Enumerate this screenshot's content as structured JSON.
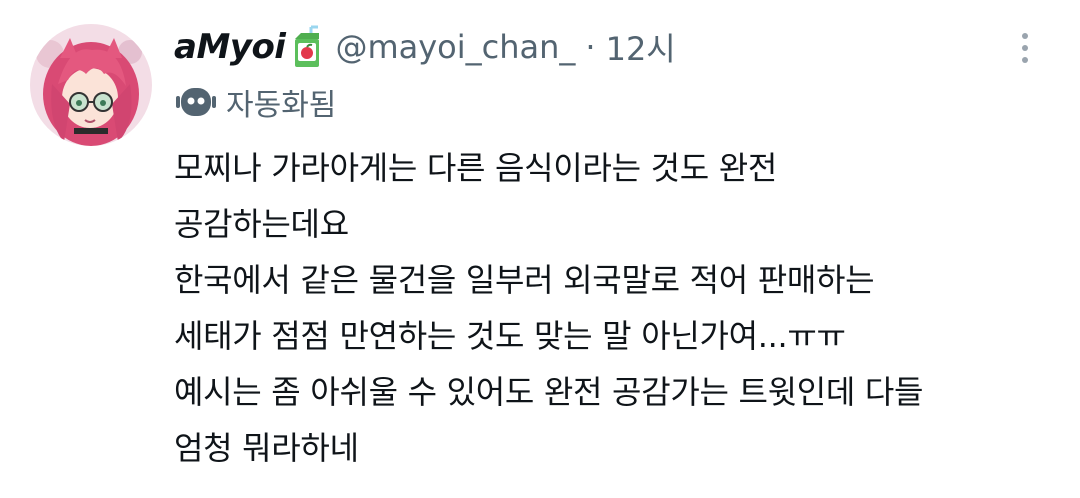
{
  "user": {
    "display_name": "aMyoi",
    "display_name_icon": "juice-box-icon",
    "handle": "@mayoi_chan_",
    "separator": "·",
    "time": "12시"
  },
  "automated": {
    "icon": "bot-icon",
    "label": "자동화됨"
  },
  "tweet": {
    "lines": [
      "모찌나 가라아게는 다른 음식이라는 것도 완전",
      "공감하는데요",
      "한국에서 같은 물건을 일부러 외국말로 적어 판매하는",
      "세태가 점점 만연하는 것도 맞는 말 아닌가여...ㅠㅠ",
      "예시는 좀 아쉬울 수 있어도 완전 공감가는 트윗인데 다들",
      "엄청 뭐라하네"
    ]
  },
  "colors": {
    "text": "#0f1419",
    "secondary": "#536471",
    "avatar_hair": "#e0537c"
  }
}
